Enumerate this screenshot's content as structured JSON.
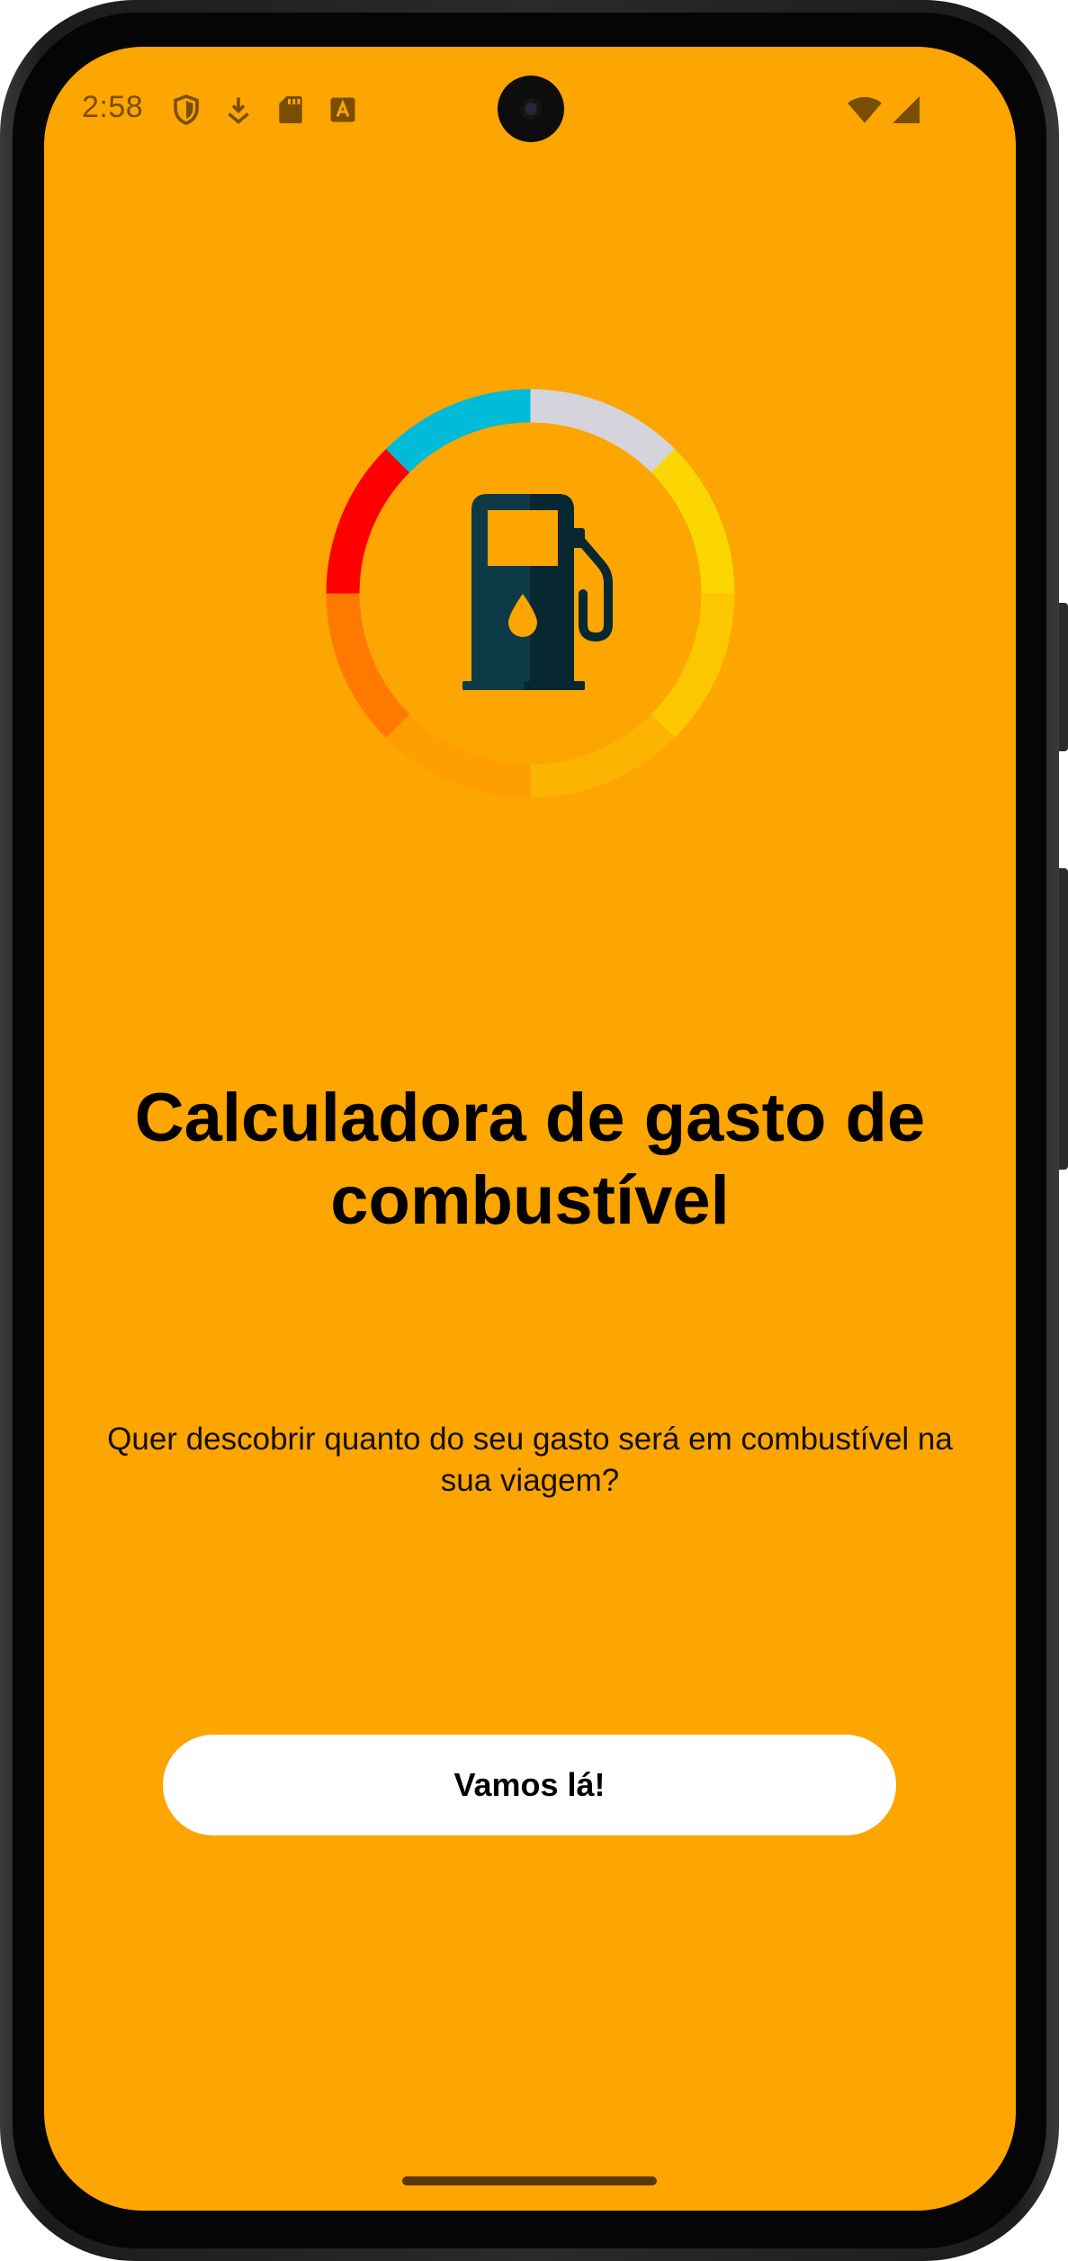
{
  "status_bar": {
    "time": "2:58",
    "left_icons": [
      "shield-icon",
      "download-icon",
      "sd-card-icon",
      "keyboard-a-icon"
    ],
    "right_icons": [
      "wifi-icon",
      "cell-signal-icon"
    ]
  },
  "logo": {
    "icon": "fuel-pump-icon",
    "ring_colors": [
      "#D5D4DC",
      "#FCD600",
      "#FDC700",
      "#FCB400",
      "#FF9E00",
      "#FF7900",
      "#FF0000",
      "#00BBD7"
    ]
  },
  "main": {
    "title": "Calculadora de gasto de combustível",
    "subtitle": "Quer descobrir quanto do seu gasto será em combustível na sua viagem?",
    "cta_label": "Vamos lá!"
  },
  "colors": {
    "background": "#FDA500",
    "button": "#FFFFFF",
    "pump_dark": "#0E3A47",
    "pump_shadow": "#082831"
  }
}
